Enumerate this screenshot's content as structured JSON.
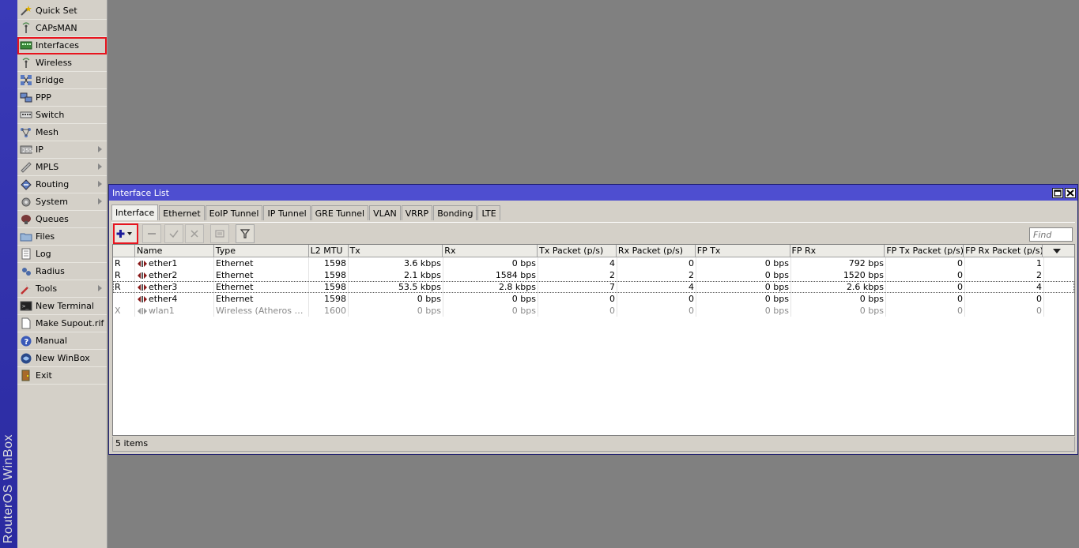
{
  "brand": "RouterOS WinBox",
  "sidebar": {
    "items": [
      {
        "label": "Quick Set",
        "icon": "wand-icon",
        "submenu": false
      },
      {
        "label": "CAPsMAN",
        "icon": "antenna-icon",
        "submenu": false
      },
      {
        "label": "Interfaces",
        "icon": "interfaces-icon",
        "submenu": false,
        "highlighted": true
      },
      {
        "label": "Wireless",
        "icon": "wireless-icon",
        "submenu": false
      },
      {
        "label": "Bridge",
        "icon": "bridge-icon",
        "submenu": false
      },
      {
        "label": "PPP",
        "icon": "ppp-icon",
        "submenu": false
      },
      {
        "label": "Switch",
        "icon": "switch-icon",
        "submenu": false
      },
      {
        "label": "Mesh",
        "icon": "mesh-icon",
        "submenu": false
      },
      {
        "label": "IP",
        "icon": "ip-icon",
        "submenu": true
      },
      {
        "label": "MPLS",
        "icon": "mpls-icon",
        "submenu": true
      },
      {
        "label": "Routing",
        "icon": "routing-icon",
        "submenu": true
      },
      {
        "label": "System",
        "icon": "gear-icon",
        "submenu": true
      },
      {
        "label": "Queues",
        "icon": "queues-icon",
        "submenu": false
      },
      {
        "label": "Files",
        "icon": "folder-icon",
        "submenu": false
      },
      {
        "label": "Log",
        "icon": "log-icon",
        "submenu": false
      },
      {
        "label": "Radius",
        "icon": "radius-icon",
        "submenu": false
      },
      {
        "label": "Tools",
        "icon": "tools-icon",
        "submenu": true
      },
      {
        "label": "New Terminal",
        "icon": "terminal-icon",
        "submenu": false
      },
      {
        "label": "Make Supout.rif",
        "icon": "document-icon",
        "submenu": false
      },
      {
        "label": "Manual",
        "icon": "help-icon",
        "submenu": false
      },
      {
        "label": "New WinBox",
        "icon": "winbox-icon",
        "submenu": false
      },
      {
        "label": "Exit",
        "icon": "exit-icon",
        "submenu": false
      }
    ]
  },
  "window": {
    "title": "Interface List",
    "tabs": [
      "Interface",
      "Ethernet",
      "EoIP Tunnel",
      "IP Tunnel",
      "GRE Tunnel",
      "VLAN",
      "VRRP",
      "Bonding",
      "LTE"
    ],
    "active_tab": "Interface",
    "find_placeholder": "Find",
    "columns": [
      "",
      "Name",
      "Type",
      "L2 MTU",
      "Tx",
      "Rx",
      "Tx Packet (p/s)",
      "Rx Packet (p/s)",
      "FP Tx",
      "FP Rx",
      "FP Tx Packet (p/s)",
      "FP Rx Packet (p/s)"
    ],
    "rows": [
      {
        "flag": "R",
        "name": "ether1",
        "type": "Ethernet",
        "l2mtu": "1598",
        "tx": "3.6 kbps",
        "rx": "0 bps",
        "tx_pkt": "4",
        "rx_pkt": "0",
        "fp_tx": "0 bps",
        "fp_rx": "792 bps",
        "fp_tx_pkt": "0",
        "fp_rx_pkt": "1",
        "disabled": false,
        "selected": false
      },
      {
        "flag": "R",
        "name": "ether2",
        "type": "Ethernet",
        "l2mtu": "1598",
        "tx": "2.1 kbps",
        "rx": "1584 bps",
        "tx_pkt": "2",
        "rx_pkt": "2",
        "fp_tx": "0 bps",
        "fp_rx": "1520 bps",
        "fp_tx_pkt": "0",
        "fp_rx_pkt": "2",
        "disabled": false,
        "selected": false
      },
      {
        "flag": "R",
        "name": "ether3",
        "type": "Ethernet",
        "l2mtu": "1598",
        "tx": "53.5 kbps",
        "rx": "2.8 kbps",
        "tx_pkt": "7",
        "rx_pkt": "4",
        "fp_tx": "0 bps",
        "fp_rx": "2.6 kbps",
        "fp_tx_pkt": "0",
        "fp_rx_pkt": "4",
        "disabled": false,
        "selected": true
      },
      {
        "flag": "",
        "name": "ether4",
        "type": "Ethernet",
        "l2mtu": "1598",
        "tx": "0 bps",
        "rx": "0 bps",
        "tx_pkt": "0",
        "rx_pkt": "0",
        "fp_tx": "0 bps",
        "fp_rx": "0 bps",
        "fp_tx_pkt": "0",
        "fp_rx_pkt": "0",
        "disabled": false,
        "selected": false
      },
      {
        "flag": "X",
        "name": "wlan1",
        "type": "Wireless (Atheros AR...",
        "l2mtu": "1600",
        "tx": "0 bps",
        "rx": "0 bps",
        "tx_pkt": "0",
        "rx_pkt": "0",
        "fp_tx": "0 bps",
        "fp_rx": "0 bps",
        "fp_tx_pkt": "0",
        "fp_rx_pkt": "0",
        "disabled": true,
        "selected": false
      }
    ],
    "status": "5 items"
  },
  "colors": {
    "title_bar": "#4e4ed0",
    "brand_strip": "#2a2aa0",
    "highlight": "#e8141e",
    "workspace": "#808080"
  }
}
